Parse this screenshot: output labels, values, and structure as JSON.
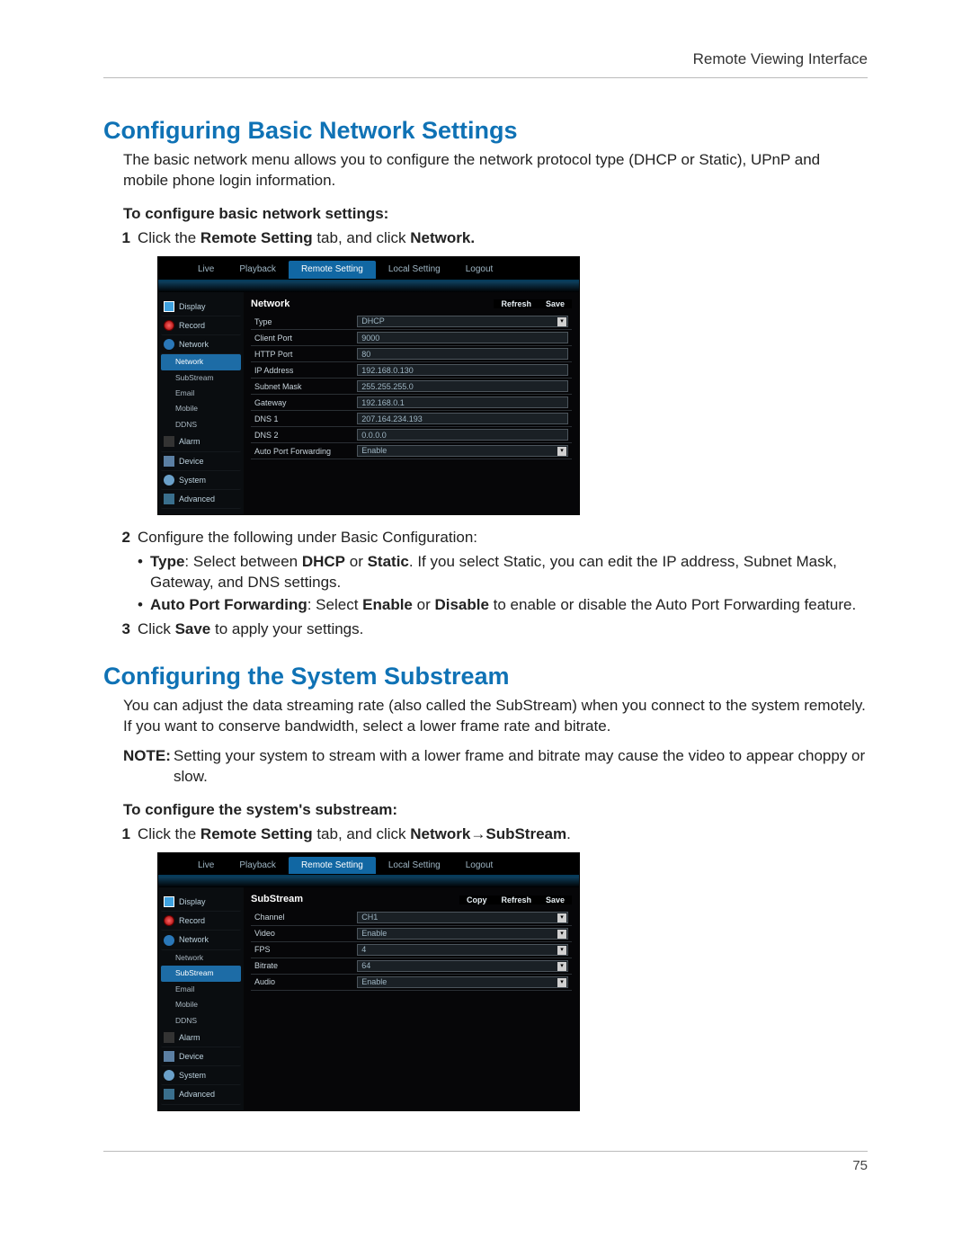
{
  "header": {
    "right": "Remote Viewing Interface"
  },
  "page_number": "75",
  "s1": {
    "title": "Configuring Basic Network Settings",
    "intro": "The basic network menu allows you to configure the network protocol type (DHCP or Static), UPnP and mobile phone login information.",
    "subhead": "To configure basic network settings:",
    "step1_a": "Click the ",
    "step1_b": "Remote Setting",
    "step1_c": " tab, and click ",
    "step1_d": "Network.",
    "step2_lead": "Configure the following under Basic Configuration:",
    "b1_a": "Type",
    "b1_b": ": Select between ",
    "b1_c": "DHCP",
    "b1_d": " or ",
    "b1_e": "Static",
    "b1_f": ". If you select Static, you can edit the IP address, Subnet Mask, Gateway, and DNS settings.",
    "b2_a": "Auto Port Forwarding",
    "b2_b": ": Select ",
    "b2_c": "Enable",
    "b2_d": " or ",
    "b2_e": "Disable",
    "b2_f": " to enable or disable the Auto Port Forwarding feature.",
    "step3_a": "Click ",
    "step3_b": "Save",
    "step3_c": " to apply your settings."
  },
  "s2": {
    "title": "Configuring the System Substream",
    "intro": "You can adjust the data streaming rate (also called the SubStream) when you connect to the system remotely. If you want to conserve bandwidth, select a lower frame rate and bitrate.",
    "note_lead": "NOTE:",
    "note_body": "Setting your system to stream with a lower frame and bitrate may cause the video to appear choppy or slow.",
    "subhead": "To configure the system's substream:",
    "step1_a": "Click the ",
    "step1_b": "Remote Setting",
    "step1_c": " tab, and click ",
    "step1_d": "Network→SubStream",
    "step1_e": "."
  },
  "tabs": {
    "live": "Live",
    "playback": "Playback",
    "remote": "Remote Setting",
    "local": "Local Setting",
    "logout": "Logout"
  },
  "side": {
    "display": "Display",
    "record": "Record",
    "network": "Network",
    "sub_network": "Network",
    "sub_substream": "SubStream",
    "sub_email": "Email",
    "sub_mobile": "Mobile",
    "sub_ddns": "DDNS",
    "alarm": "Alarm",
    "device": "Device",
    "system": "System",
    "advanced": "Advanced"
  },
  "panel1": {
    "title": "Network",
    "refresh": "Refresh",
    "save": "Save",
    "rows": {
      "type_l": "Type",
      "type_v": "DHCP",
      "client_l": "Client Port",
      "client_v": "9000",
      "http_l": "HTTP Port",
      "http_v": "80",
      "ip_l": "IP Address",
      "ip_v": "192.168.0.130",
      "mask_l": "Subnet Mask",
      "mask_v": "255.255.255.0",
      "gw_l": "Gateway",
      "gw_v": "192.168.0.1",
      "dns1_l": "DNS 1",
      "dns1_v": "207.164.234.193",
      "dns2_l": "DNS 2",
      "dns2_v": "0.0.0.0",
      "apf_l": "Auto Port Forwarding",
      "apf_v": "Enable"
    }
  },
  "panel2": {
    "title": "SubStream",
    "copy": "Copy",
    "refresh": "Refresh",
    "save": "Save",
    "rows": {
      "ch_l": "Channel",
      "ch_v": "CH1",
      "video_l": "Video",
      "video_v": "Enable",
      "fps_l": "FPS",
      "fps_v": "4",
      "bit_l": "Bitrate",
      "bit_v": "64",
      "audio_l": "Audio",
      "audio_v": "Enable"
    }
  }
}
